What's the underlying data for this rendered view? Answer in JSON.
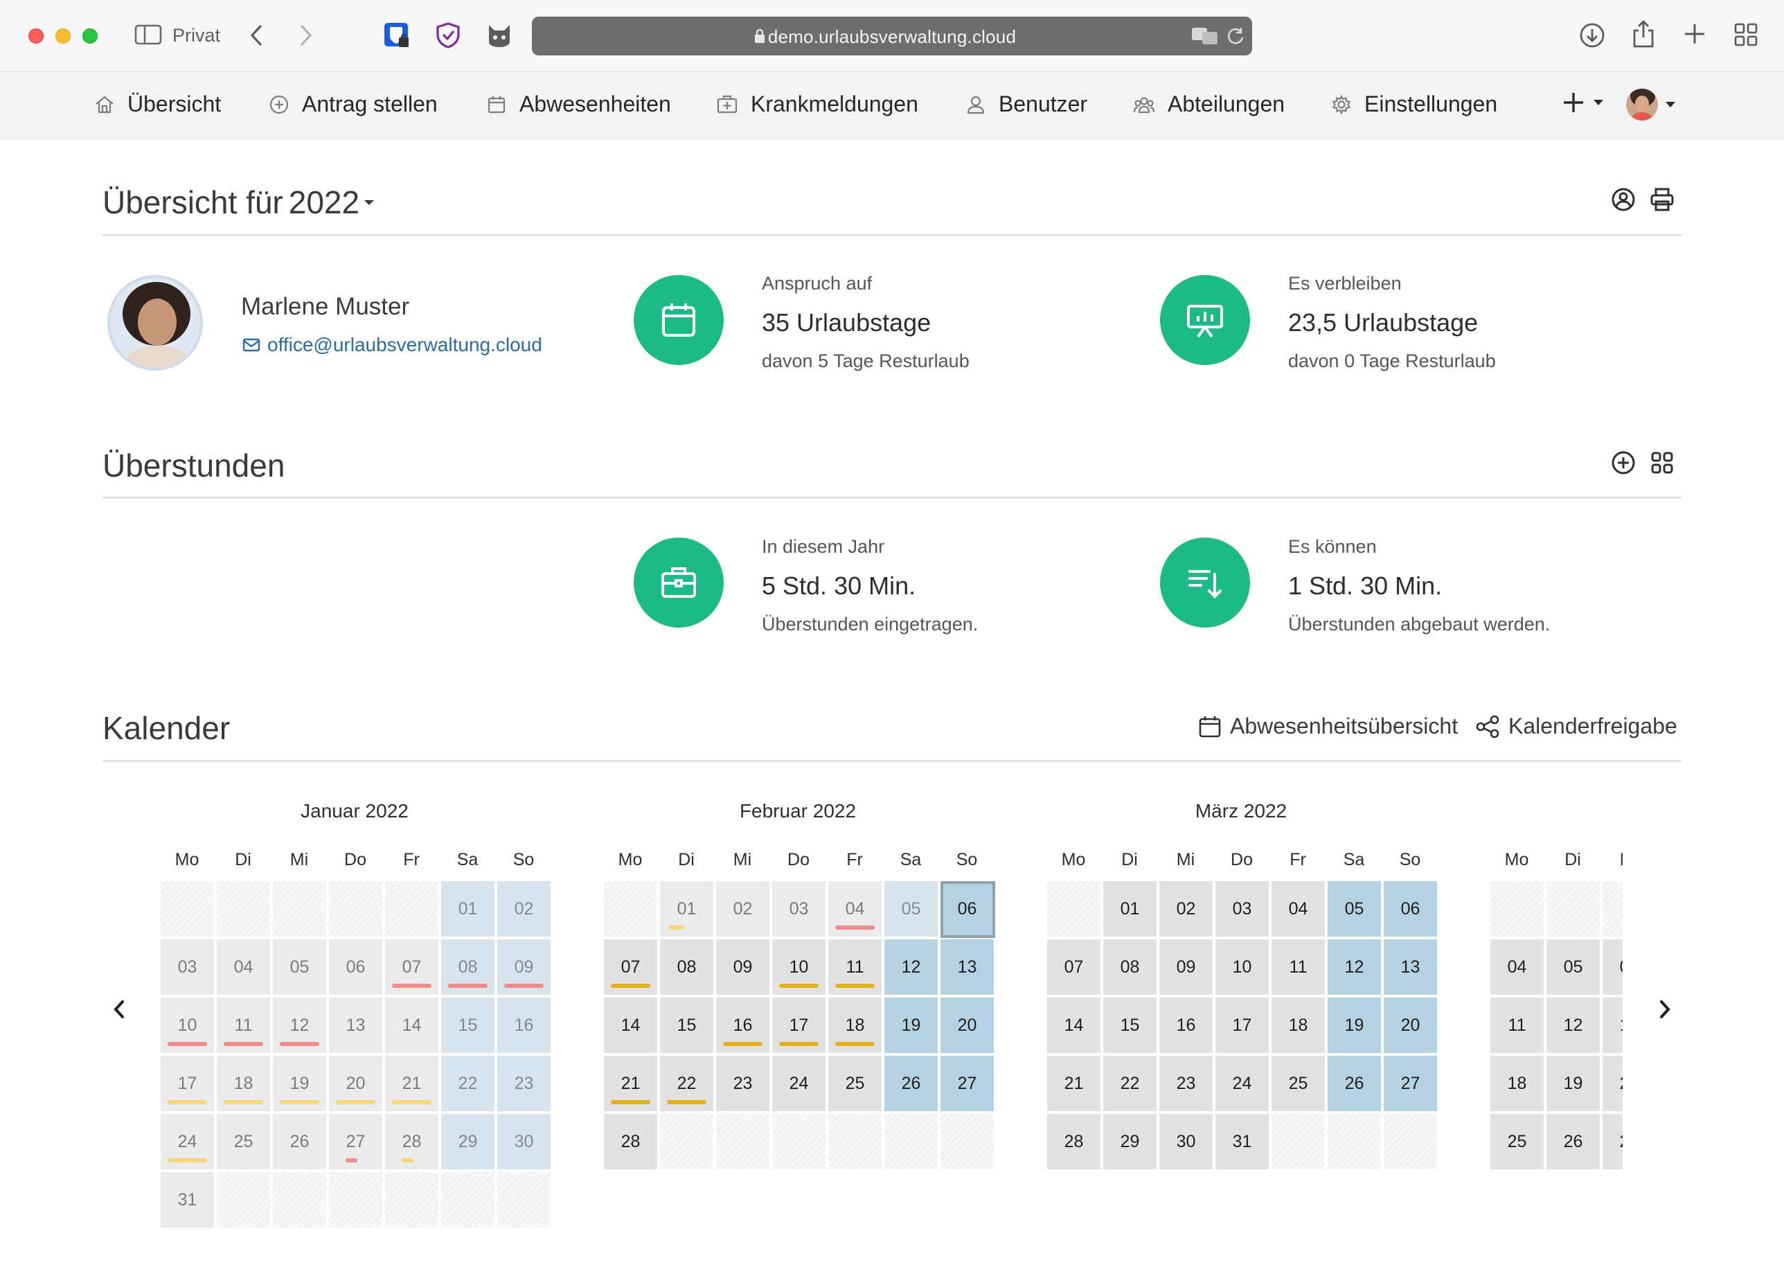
{
  "browser": {
    "profile_label": "Privat",
    "url": "demo.urlaubsverwaltung.cloud"
  },
  "nav": {
    "items": [
      {
        "label": "Übersicht",
        "icon": "home-icon"
      },
      {
        "label": "Antrag stellen",
        "icon": "plus-circle-icon"
      },
      {
        "label": "Abwesenheiten",
        "icon": "calendar-icon"
      },
      {
        "label": "Krankmeldungen",
        "icon": "medical-case-icon"
      },
      {
        "label": "Benutzer",
        "icon": "user-icon"
      },
      {
        "label": "Abteilungen",
        "icon": "users-icon"
      },
      {
        "label": "Einstellungen",
        "icon": "gear-icon"
      }
    ]
  },
  "overview": {
    "title_prefix": "Übersicht für",
    "year": "2022",
    "user_name": "Marlene Muster",
    "user_email": "office@urlaubsverwaltung.cloud",
    "entitlement": {
      "label": "Anspruch auf",
      "value": "35 Urlaubstage",
      "sub": "davon 5 Tage Resturlaub"
    },
    "remaining": {
      "label": "Es verbleiben",
      "value": "23,5 Urlaubstage",
      "sub": "davon 0 Tage Resturlaub"
    }
  },
  "overtime": {
    "title": "Überstunden",
    "this_year": {
      "label": "In diesem Jahr",
      "value": "5 Std. 30 Min.",
      "sub": "Überstunden eingetragen."
    },
    "can_reduce": {
      "label": "Es können",
      "value": "1 Std. 30 Min.",
      "sub": "Überstunden abgebaut werden."
    }
  },
  "calendar": {
    "title": "Kalender",
    "absence_overview_link": "Abwesenheitsübersicht",
    "calendar_share_link": "Kalenderfreigabe",
    "weekday_labels": [
      "Mo",
      "Di",
      "Mi",
      "Do",
      "Fr",
      "Sa",
      "So"
    ],
    "months": [
      {
        "title": "Januar 2022",
        "offset": 5,
        "days": 31,
        "today": null,
        "all_past": true,
        "marks": {
          "7": "red",
          "8": "red",
          "9": "red",
          "10": "red",
          "11": "red",
          "12": "red",
          "17": "yellow",
          "18": "yellow",
          "19": "yellow",
          "20": "yellow",
          "21": "yellow",
          "24": "yellow",
          "27": "red-tiny",
          "28": "yellow-tiny"
        }
      },
      {
        "title": "Februar 2022",
        "offset": 1,
        "days": 28,
        "today": 6,
        "past_until": 5,
        "marks": {
          "1": "yellow-tinyL",
          "4": "red",
          "7": "gold",
          "10": "gold",
          "11": "gold",
          "16": "gold",
          "17": "gold",
          "18": "gold",
          "21": "gold",
          "22": "gold"
        }
      },
      {
        "title": "März 2022",
        "offset": 1,
        "days": 31,
        "today": null,
        "past_until": 0,
        "marks": {}
      },
      {
        "title": "",
        "offset": 4,
        "days": 30,
        "today": null,
        "past_until": 0,
        "marks": {},
        "partial": true
      }
    ]
  }
}
